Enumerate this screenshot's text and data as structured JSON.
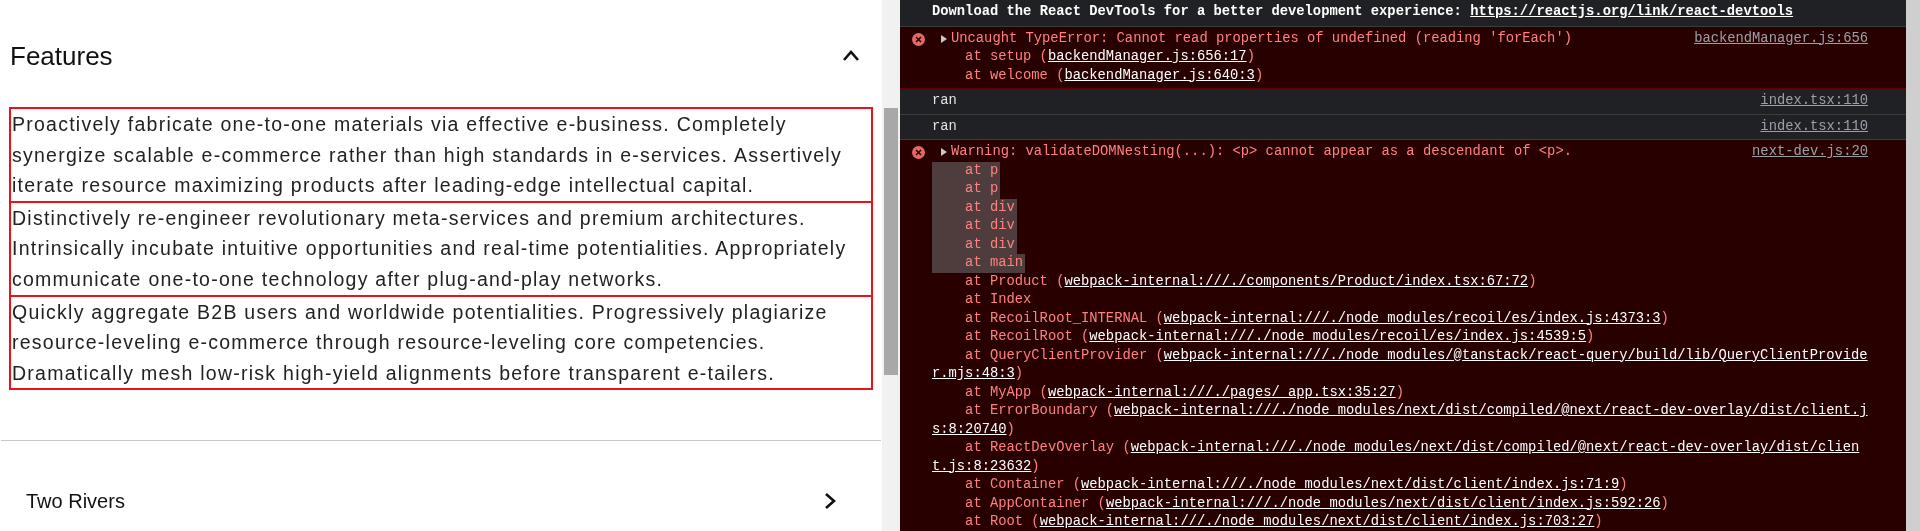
{
  "page": {
    "sections": [
      {
        "title": "Features",
        "expanded": true,
        "paragraphs": [
          "Proactively fabricate one-to-one materials via effective e-business. Completely synergize scalable e-commerce rather than high standards in e-services. Assertively iterate resource maximizing products after leading-edge intellectual capital.",
          "Distinctively re-engineer revolutionary meta-services and premium architectures. Intrinsically incubate intuitive opportunities and real-time potentialities. Appropriately communicate one-to-one technology after plug-and-play networks.",
          "Quickly aggregate B2B users and worldwide potentialities. Progressively plagiarize resource-leveling e-commerce through resource-leveling core competencies. Dramatically mesh low-risk high-yield alignments before transparent e-tailers."
        ]
      },
      {
        "title": "Two Rivers",
        "expanded": false
      }
    ]
  },
  "console": {
    "messages": [
      {
        "kind": "info",
        "text": "Download the React DevTools for a better development experience: ",
        "link": "https://reactjs.org/link/react-devtools"
      },
      {
        "kind": "error",
        "text": "Uncaught TypeError: Cannot read properties of undefined (reading 'forEach')",
        "source": "backendManager.js:656",
        "stack": [
          {
            "text": "at setup (",
            "link": "backendManager.js:656:17",
            "end": ")",
            "highlighted": false
          },
          {
            "text": "at welcome (",
            "link": "backendManager.js:640:3",
            "end": ")",
            "highlighted": false
          }
        ]
      },
      {
        "kind": "log",
        "text": "ran",
        "source": "index.tsx:110"
      },
      {
        "kind": "log",
        "text": "ran",
        "source": "index.tsx:110"
      },
      {
        "kind": "error",
        "text": "Warning: validateDOMNesting(...): <p> cannot appear as a descendant of <p>.",
        "source": "next-dev.js:20",
        "stack": [
          {
            "text": "at p",
            "highlighted": true
          },
          {
            "text": "at p",
            "highlighted": true
          },
          {
            "text": "at div",
            "highlighted": true
          },
          {
            "text": "at div",
            "highlighted": true
          },
          {
            "text": "at div",
            "highlighted": true
          },
          {
            "text": "at main",
            "highlighted": true
          },
          {
            "text": "at Product (",
            "link": "webpack-internal:///./components/Product/index.tsx:67:72",
            "end": ")",
            "highlighted": false
          },
          {
            "text": "at Index",
            "highlighted": false
          },
          {
            "text": "at RecoilRoot_INTERNAL (",
            "link": "webpack-internal:///./node_modules/recoil/es/index.js:4373:3",
            "end": ")",
            "highlighted": false
          },
          {
            "text": "at RecoilRoot (",
            "link": "webpack-internal:///./node_modules/recoil/es/index.js:4539:5",
            "end": ")",
            "highlighted": false
          },
          {
            "text": "at QueryClientProvider (",
            "link": "webpack-internal:///./node_modules/@tanstack/react-query/build/lib/QueryClientProvider.mjs:48:3",
            "end": ")",
            "highlighted": false
          },
          {
            "text": "at MyApp (",
            "link": "webpack-internal:///./pages/_app.tsx:35:27",
            "end": ")",
            "highlighted": false
          },
          {
            "text": "at ErrorBoundary (",
            "link": "webpack-internal:///./node_modules/next/dist/compiled/@next/react-dev-overlay/dist/client.js:8:20740",
            "end": ")",
            "highlighted": false
          },
          {
            "text": "at ReactDevOverlay (",
            "link": "webpack-internal:///./node_modules/next/dist/compiled/@next/react-dev-overlay/dist/client.js:8:23632",
            "end": ")",
            "highlighted": false
          },
          {
            "text": "at Container (",
            "link": "webpack-internal:///./node_modules/next/dist/client/index.js:71:9",
            "end": ")",
            "highlighted": false
          },
          {
            "text": "at AppContainer (",
            "link": "webpack-internal:///./node_modules/next/dist/client/index.js:592:26",
            "end": ")",
            "highlighted": false
          },
          {
            "text": "at Root (",
            "link": "webpack-internal:///./node_modules/next/dist/client/index.js:703:27",
            "end": ")",
            "highlighted": false
          }
        ]
      }
    ]
  }
}
